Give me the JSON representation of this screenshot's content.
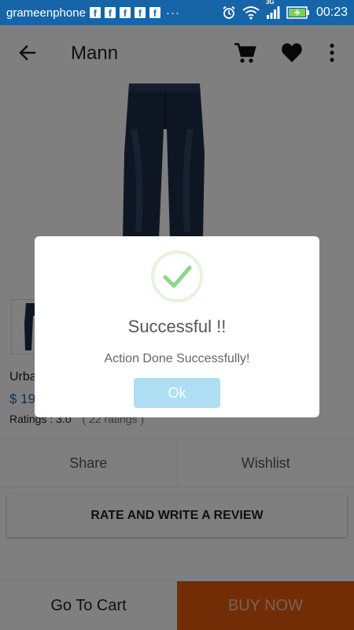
{
  "status_bar": {
    "carrier": "grameenphone",
    "fb_icons": [
      "f",
      "f",
      "f",
      "f",
      "f"
    ],
    "dots": "···",
    "network": "3G",
    "time": "00:23"
  },
  "app_bar": {
    "title": "Mann"
  },
  "product": {
    "name": "Urba",
    "price": "$ 19",
    "ratings": "Ratings : 3.0",
    "ratings_count": "( 22 ratings )"
  },
  "actions": {
    "share": "Share",
    "wishlist": "Wishlist"
  },
  "review_button": "RATE AND WRITE A REVIEW",
  "bottom_bar": {
    "go_to_cart": "Go To Cart",
    "buy_now": "BUY NOW"
  },
  "dialog": {
    "title": "Successful !!",
    "message": "Action Done Successfully!",
    "ok_label": "Ok"
  },
  "colors": {
    "status_bar": "#1565a8",
    "buy_now": "#e55b0f",
    "ok_button": "#aedef4",
    "check": "#8fd68a"
  }
}
